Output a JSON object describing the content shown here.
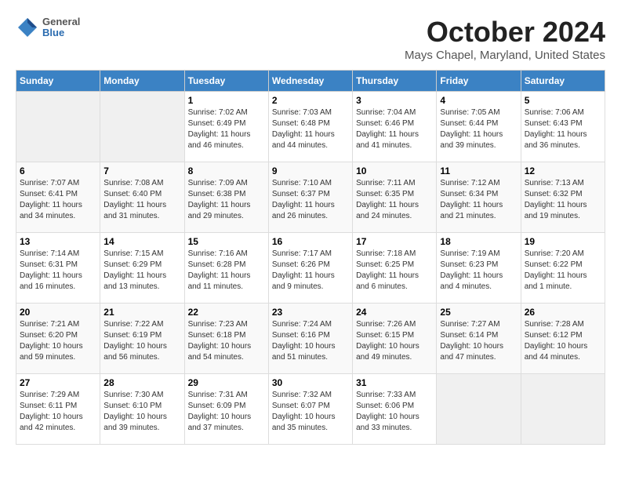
{
  "header": {
    "logo_general": "General",
    "logo_blue": "Blue",
    "month": "October 2024",
    "location": "Mays Chapel, Maryland, United States"
  },
  "weekdays": [
    "Sunday",
    "Monday",
    "Tuesday",
    "Wednesday",
    "Thursday",
    "Friday",
    "Saturday"
  ],
  "weeks": [
    [
      {
        "day": "",
        "sunrise": "",
        "sunset": "",
        "daylight": ""
      },
      {
        "day": "",
        "sunrise": "",
        "sunset": "",
        "daylight": ""
      },
      {
        "day": "1",
        "sunrise": "Sunrise: 7:02 AM",
        "sunset": "Sunset: 6:49 PM",
        "daylight": "Daylight: 11 hours and 46 minutes."
      },
      {
        "day": "2",
        "sunrise": "Sunrise: 7:03 AM",
        "sunset": "Sunset: 6:48 PM",
        "daylight": "Daylight: 11 hours and 44 minutes."
      },
      {
        "day": "3",
        "sunrise": "Sunrise: 7:04 AM",
        "sunset": "Sunset: 6:46 PM",
        "daylight": "Daylight: 11 hours and 41 minutes."
      },
      {
        "day": "4",
        "sunrise": "Sunrise: 7:05 AM",
        "sunset": "Sunset: 6:44 PM",
        "daylight": "Daylight: 11 hours and 39 minutes."
      },
      {
        "day": "5",
        "sunrise": "Sunrise: 7:06 AM",
        "sunset": "Sunset: 6:43 PM",
        "daylight": "Daylight: 11 hours and 36 minutes."
      }
    ],
    [
      {
        "day": "6",
        "sunrise": "Sunrise: 7:07 AM",
        "sunset": "Sunset: 6:41 PM",
        "daylight": "Daylight: 11 hours and 34 minutes."
      },
      {
        "day": "7",
        "sunrise": "Sunrise: 7:08 AM",
        "sunset": "Sunset: 6:40 PM",
        "daylight": "Daylight: 11 hours and 31 minutes."
      },
      {
        "day": "8",
        "sunrise": "Sunrise: 7:09 AM",
        "sunset": "Sunset: 6:38 PM",
        "daylight": "Daylight: 11 hours and 29 minutes."
      },
      {
        "day": "9",
        "sunrise": "Sunrise: 7:10 AM",
        "sunset": "Sunset: 6:37 PM",
        "daylight": "Daylight: 11 hours and 26 minutes."
      },
      {
        "day": "10",
        "sunrise": "Sunrise: 7:11 AM",
        "sunset": "Sunset: 6:35 PM",
        "daylight": "Daylight: 11 hours and 24 minutes."
      },
      {
        "day": "11",
        "sunrise": "Sunrise: 7:12 AM",
        "sunset": "Sunset: 6:34 PM",
        "daylight": "Daylight: 11 hours and 21 minutes."
      },
      {
        "day": "12",
        "sunrise": "Sunrise: 7:13 AM",
        "sunset": "Sunset: 6:32 PM",
        "daylight": "Daylight: 11 hours and 19 minutes."
      }
    ],
    [
      {
        "day": "13",
        "sunrise": "Sunrise: 7:14 AM",
        "sunset": "Sunset: 6:31 PM",
        "daylight": "Daylight: 11 hours and 16 minutes."
      },
      {
        "day": "14",
        "sunrise": "Sunrise: 7:15 AM",
        "sunset": "Sunset: 6:29 PM",
        "daylight": "Daylight: 11 hours and 13 minutes."
      },
      {
        "day": "15",
        "sunrise": "Sunrise: 7:16 AM",
        "sunset": "Sunset: 6:28 PM",
        "daylight": "Daylight: 11 hours and 11 minutes."
      },
      {
        "day": "16",
        "sunrise": "Sunrise: 7:17 AM",
        "sunset": "Sunset: 6:26 PM",
        "daylight": "Daylight: 11 hours and 9 minutes."
      },
      {
        "day": "17",
        "sunrise": "Sunrise: 7:18 AM",
        "sunset": "Sunset: 6:25 PM",
        "daylight": "Daylight: 11 hours and 6 minutes."
      },
      {
        "day": "18",
        "sunrise": "Sunrise: 7:19 AM",
        "sunset": "Sunset: 6:23 PM",
        "daylight": "Daylight: 11 hours and 4 minutes."
      },
      {
        "day": "19",
        "sunrise": "Sunrise: 7:20 AM",
        "sunset": "Sunset: 6:22 PM",
        "daylight": "Daylight: 11 hours and 1 minute."
      }
    ],
    [
      {
        "day": "20",
        "sunrise": "Sunrise: 7:21 AM",
        "sunset": "Sunset: 6:20 PM",
        "daylight": "Daylight: 10 hours and 59 minutes."
      },
      {
        "day": "21",
        "sunrise": "Sunrise: 7:22 AM",
        "sunset": "Sunset: 6:19 PM",
        "daylight": "Daylight: 10 hours and 56 minutes."
      },
      {
        "day": "22",
        "sunrise": "Sunrise: 7:23 AM",
        "sunset": "Sunset: 6:18 PM",
        "daylight": "Daylight: 10 hours and 54 minutes."
      },
      {
        "day": "23",
        "sunrise": "Sunrise: 7:24 AM",
        "sunset": "Sunset: 6:16 PM",
        "daylight": "Daylight: 10 hours and 51 minutes."
      },
      {
        "day": "24",
        "sunrise": "Sunrise: 7:26 AM",
        "sunset": "Sunset: 6:15 PM",
        "daylight": "Daylight: 10 hours and 49 minutes."
      },
      {
        "day": "25",
        "sunrise": "Sunrise: 7:27 AM",
        "sunset": "Sunset: 6:14 PM",
        "daylight": "Daylight: 10 hours and 47 minutes."
      },
      {
        "day": "26",
        "sunrise": "Sunrise: 7:28 AM",
        "sunset": "Sunset: 6:12 PM",
        "daylight": "Daylight: 10 hours and 44 minutes."
      }
    ],
    [
      {
        "day": "27",
        "sunrise": "Sunrise: 7:29 AM",
        "sunset": "Sunset: 6:11 PM",
        "daylight": "Daylight: 10 hours and 42 minutes."
      },
      {
        "day": "28",
        "sunrise": "Sunrise: 7:30 AM",
        "sunset": "Sunset: 6:10 PM",
        "daylight": "Daylight: 10 hours and 39 minutes."
      },
      {
        "day": "29",
        "sunrise": "Sunrise: 7:31 AM",
        "sunset": "Sunset: 6:09 PM",
        "daylight": "Daylight: 10 hours and 37 minutes."
      },
      {
        "day": "30",
        "sunrise": "Sunrise: 7:32 AM",
        "sunset": "Sunset: 6:07 PM",
        "daylight": "Daylight: 10 hours and 35 minutes."
      },
      {
        "day": "31",
        "sunrise": "Sunrise: 7:33 AM",
        "sunset": "Sunset: 6:06 PM",
        "daylight": "Daylight: 10 hours and 33 minutes."
      },
      {
        "day": "",
        "sunrise": "",
        "sunset": "",
        "daylight": ""
      },
      {
        "day": "",
        "sunrise": "",
        "sunset": "",
        "daylight": ""
      }
    ]
  ]
}
